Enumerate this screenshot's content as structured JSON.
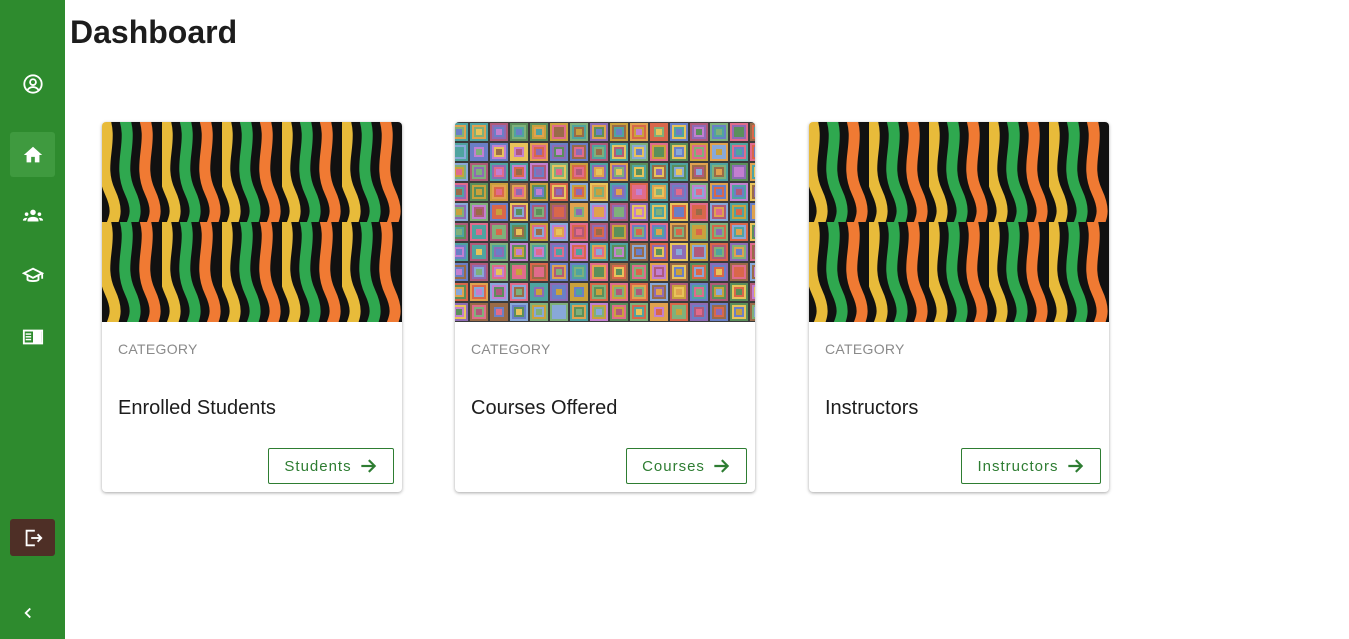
{
  "page": {
    "title": "Dashboard"
  },
  "sidebar": {
    "items": [
      {
        "icon": "account-circle-icon",
        "active": false
      },
      {
        "icon": "home-icon",
        "active": true
      },
      {
        "icon": "group-icon",
        "active": false
      },
      {
        "icon": "school-icon",
        "active": false
      },
      {
        "icon": "menu-book-icon",
        "active": false
      }
    ],
    "logout_icon": "logout-icon",
    "collapse_icon": "chevron-left-icon"
  },
  "cards": [
    {
      "category": "CATEGORY",
      "title": "Enrolled Students",
      "button_label": "Students",
      "button_icon": "arrow-right-icon",
      "image": "waves-pattern"
    },
    {
      "category": "CATEGORY",
      "title": "Courses Offered",
      "button_label": "Courses",
      "button_icon": "arrow-right-icon",
      "image": "squares-pattern"
    },
    {
      "category": "CATEGORY",
      "title": "Instructors",
      "button_label": "Instructors",
      "button_icon": "arrow-right-icon",
      "image": "waves-pattern"
    }
  ],
  "colors": {
    "sidebar": "#2e8b2e",
    "sidebar_active": "#3f9a3f",
    "logout": "#4e2f26",
    "accent": "#2e7d32"
  }
}
